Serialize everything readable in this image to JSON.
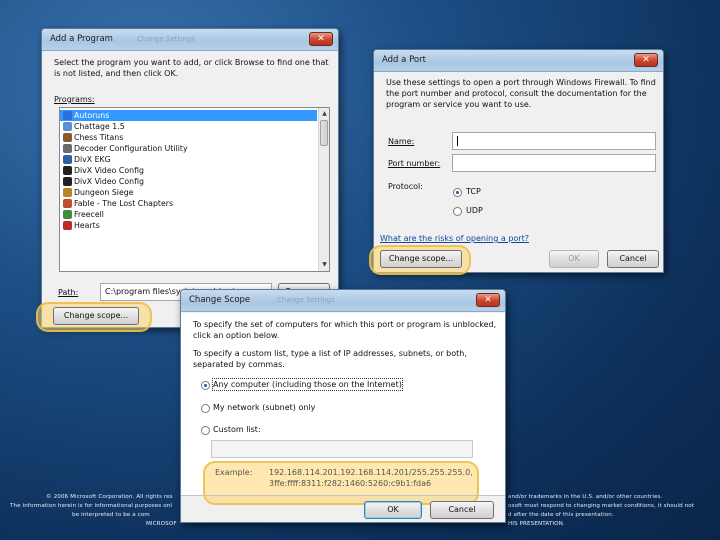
{
  "footer": {
    "l1": "© 2006 Microsoft Corporation. All rights res",
    "r1": "and/or trademarks in the U.S. and/or other countries.",
    "l2": "The information herein is for informational purposes onl",
    "r2": "osoft must respond to changing market conditions, it should not",
    "l3": "be interpreted to be a com",
    "r3": "d after the date of this presentation.",
    "l4": "MICROSOF",
    "r4": "HIS PRESENTATION."
  },
  "add_program": {
    "title": "Add a Program",
    "ghost": "Change Settings",
    "close": "✕",
    "instructions": "Select the program you want to add, or click Browse to find one that is not listed, and then click OK.",
    "programs_label": "Programs:",
    "programs": [
      {
        "name": "Autoruns",
        "selected": true,
        "color": "#2a6fd6"
      },
      {
        "name": "Chattage 1.5",
        "selected": false,
        "color": "#5a8fd4"
      },
      {
        "name": "Chess Titans",
        "selected": false,
        "color": "#8b5a2b"
      },
      {
        "name": "Decoder Configuration Utility",
        "selected": false,
        "color": "#6a6a6a"
      },
      {
        "name": "DivX EKG",
        "selected": false,
        "color": "#2d5fa8"
      },
      {
        "name": "DivX Video Config",
        "selected": false,
        "color": "#222222"
      },
      {
        "name": "DivX Video Config",
        "selected": false,
        "color": "#222222"
      },
      {
        "name": "Dungeon Siege",
        "selected": false,
        "color": "#b8862b"
      },
      {
        "name": "Fable - The Lost Chapters",
        "selected": false,
        "color": "#c24d2a"
      },
      {
        "name": "Freecell",
        "selected": false,
        "color": "#3f8f3f"
      },
      {
        "name": "Hearts",
        "selected": false,
        "color": "#c22a2a"
      }
    ],
    "path_label": "Path:",
    "path_value": "C:\\program files\\sysinternals\\autoruns.exe",
    "browse": "Browse...",
    "change_scope": "Change scope..."
  },
  "add_port": {
    "title": "Add a Port",
    "close": "✕",
    "instructions": "Use these settings to open a port through Windows Firewall. To find the port number and protocol, consult the documentation for the program or service you want to use.",
    "name_label": "Name:",
    "port_label": "Port number:",
    "protocol_label": "Protocol:",
    "tcp": "TCP",
    "udp": "UDP",
    "risks_link": "What are the risks of opening a port?",
    "change_scope": "Change scope...",
    "ok": "OK",
    "cancel": "Cancel"
  },
  "change_scope": {
    "title": "Change Scope",
    "ghost": "Change Settings",
    "close": "✕",
    "instructions": "To specify the set of computers for which this port or program is unblocked, click an option below.",
    "custom_hint": "To specify a custom list, type a list of IP addresses, subnets, or both, separated by commas.",
    "option_any": "Any computer (including those on the Internet)",
    "option_network": "My network (subnet) only",
    "option_custom": "Custom list:",
    "example_label": "Example:",
    "example_line1": "192.168.114.201,192.168.114.201/255.255.255.0,",
    "example_line2": "3ffe:ffff:8311:f282:1460:5260:c9b1:fda6",
    "ok": "OK",
    "cancel": "Cancel"
  }
}
